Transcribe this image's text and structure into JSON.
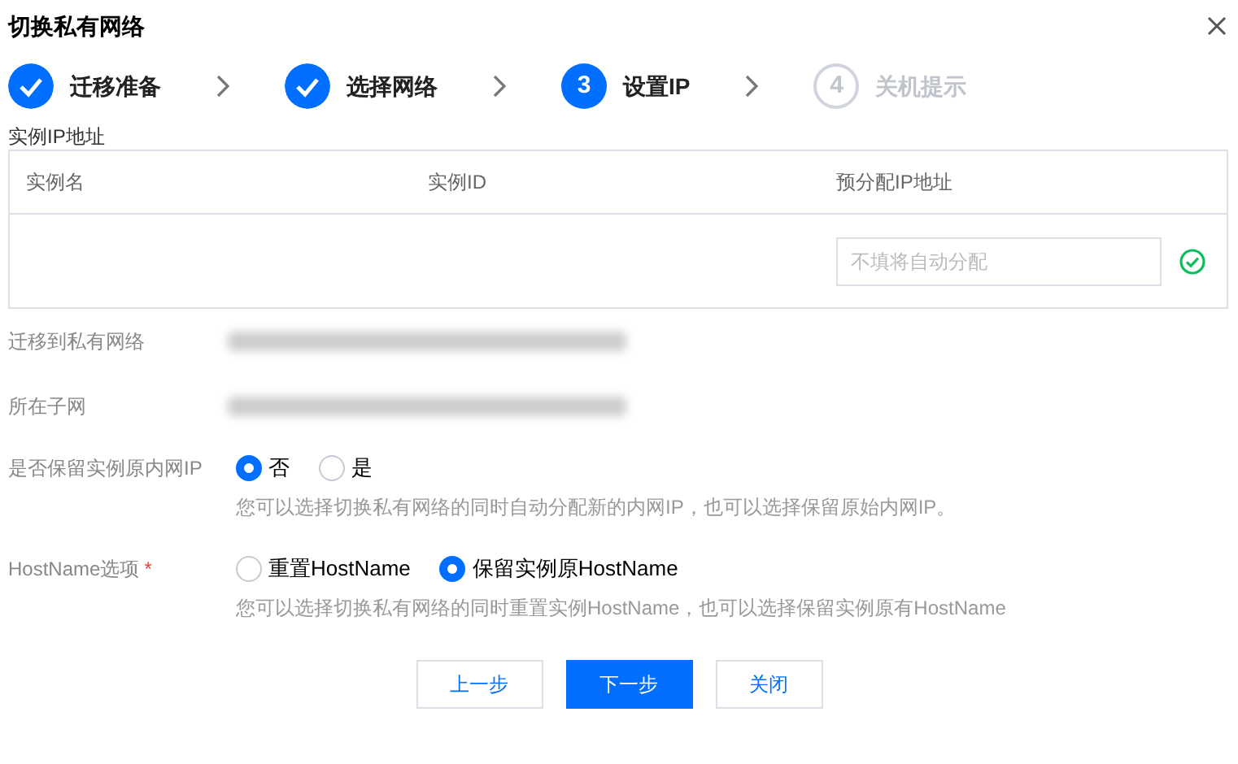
{
  "dialog": {
    "title": "切换私有网络"
  },
  "steps": [
    {
      "label": "迁移准备",
      "completed": true,
      "selected": false
    },
    {
      "label": "选择网络",
      "completed": true,
      "selected": false
    },
    {
      "label": "设置IP",
      "completed": false,
      "selected": true,
      "number": "3"
    },
    {
      "label": "关机提示",
      "completed": false,
      "selected": false,
      "number": "4"
    }
  ],
  "section_label": "实例IP地址",
  "table": {
    "columns": [
      "实例名",
      "实例ID",
      "预分配IP地址"
    ],
    "rows": [
      {
        "ip_placeholder": "不填将自动分配",
        "valid": true
      }
    ]
  },
  "info_rows": [
    {
      "label": "迁移到私有网络"
    },
    {
      "label": "所在子网"
    }
  ],
  "options": [
    {
      "label": "是否保留实例原内网IP",
      "choices": [
        {
          "label": "否",
          "selected": true
        },
        {
          "label": "是",
          "selected": false
        }
      ],
      "hint": "您可以选择切换私有网络的同时自动分配新的内网IP，也可以选择保留原始内网IP。"
    },
    {
      "label": "HostName选项",
      "required_mark": "*",
      "choices": [
        {
          "label": "重置HostName",
          "selected": false
        },
        {
          "label": "保留实例原HostName",
          "selected": true
        }
      ],
      "hint": "您可以选择切换私有网络的同时重置实例HostName，也可以选择保留实例原有HostName"
    }
  ],
  "buttons": [
    {
      "label": "上一步",
      "kind": "secondary"
    },
    {
      "label": "下一步",
      "kind": "primary"
    },
    {
      "label": "关闭",
      "kind": "secondary"
    }
  ]
}
